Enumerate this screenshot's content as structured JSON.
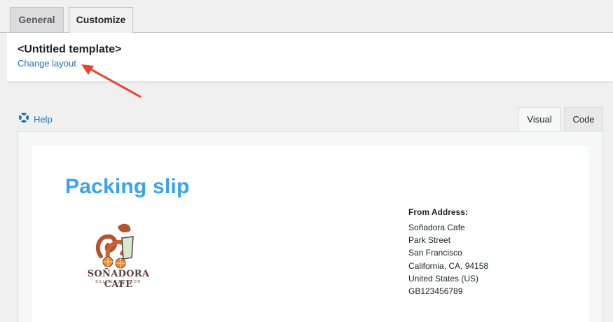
{
  "top_tabs": [
    {
      "label": "General",
      "active": false
    },
    {
      "label": "Customize",
      "active": true
    }
  ],
  "header": {
    "template_title": "<Untitled template>",
    "change_layout_label": "Change layout"
  },
  "help": {
    "label": "Help",
    "icon": "lifebuoy-icon"
  },
  "editor_tabs": [
    {
      "label": "Visual",
      "active": true
    },
    {
      "label": "Code",
      "active": false
    }
  ],
  "document": {
    "title": "Packing slip",
    "logo": {
      "name": "SOÑADORA CAFE",
      "tagline": "DELICIOUS FOOD"
    },
    "from_address": {
      "heading": "From Address:",
      "lines": [
        "Soñadora Cafe",
        "Park Street",
        "San Francisco",
        "California, CA, 94158",
        "United States (US)",
        "GB123456789"
      ]
    }
  },
  "colors": {
    "accent_link": "#2271b1",
    "slip_title": "#39a3f0",
    "annotation_arrow": "#e8432e"
  }
}
